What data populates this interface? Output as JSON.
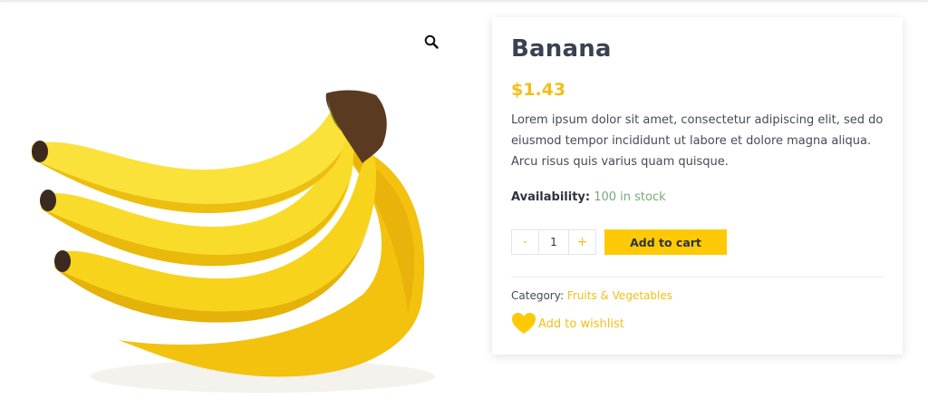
{
  "product": {
    "title": "Banana",
    "price": "$1.43",
    "description": "Lorem ipsum dolor sit amet, consectetur adipiscing elit, sed do eiusmod tempor incididunt ut labore et dolore magna aliqua. Arcu risus quis varius quam quisque.",
    "availability_label": "Availability:",
    "availability_value": "100 in stock",
    "image_alt": "Banana"
  },
  "cart": {
    "decrement_label": "-",
    "quantity": "1",
    "increment_label": "+",
    "add_to_cart_label": "Add to cart"
  },
  "meta": {
    "category_label": "Category:",
    "category_value": "Fruits & Vegetables",
    "wishlist_label": "Add to wishlist"
  },
  "icons": {
    "zoom": "search-icon",
    "wishlist": "heart-icon"
  },
  "colors": {
    "accent": "#f2bf16",
    "button": "#ffc905",
    "stock": "#7aa87a"
  }
}
